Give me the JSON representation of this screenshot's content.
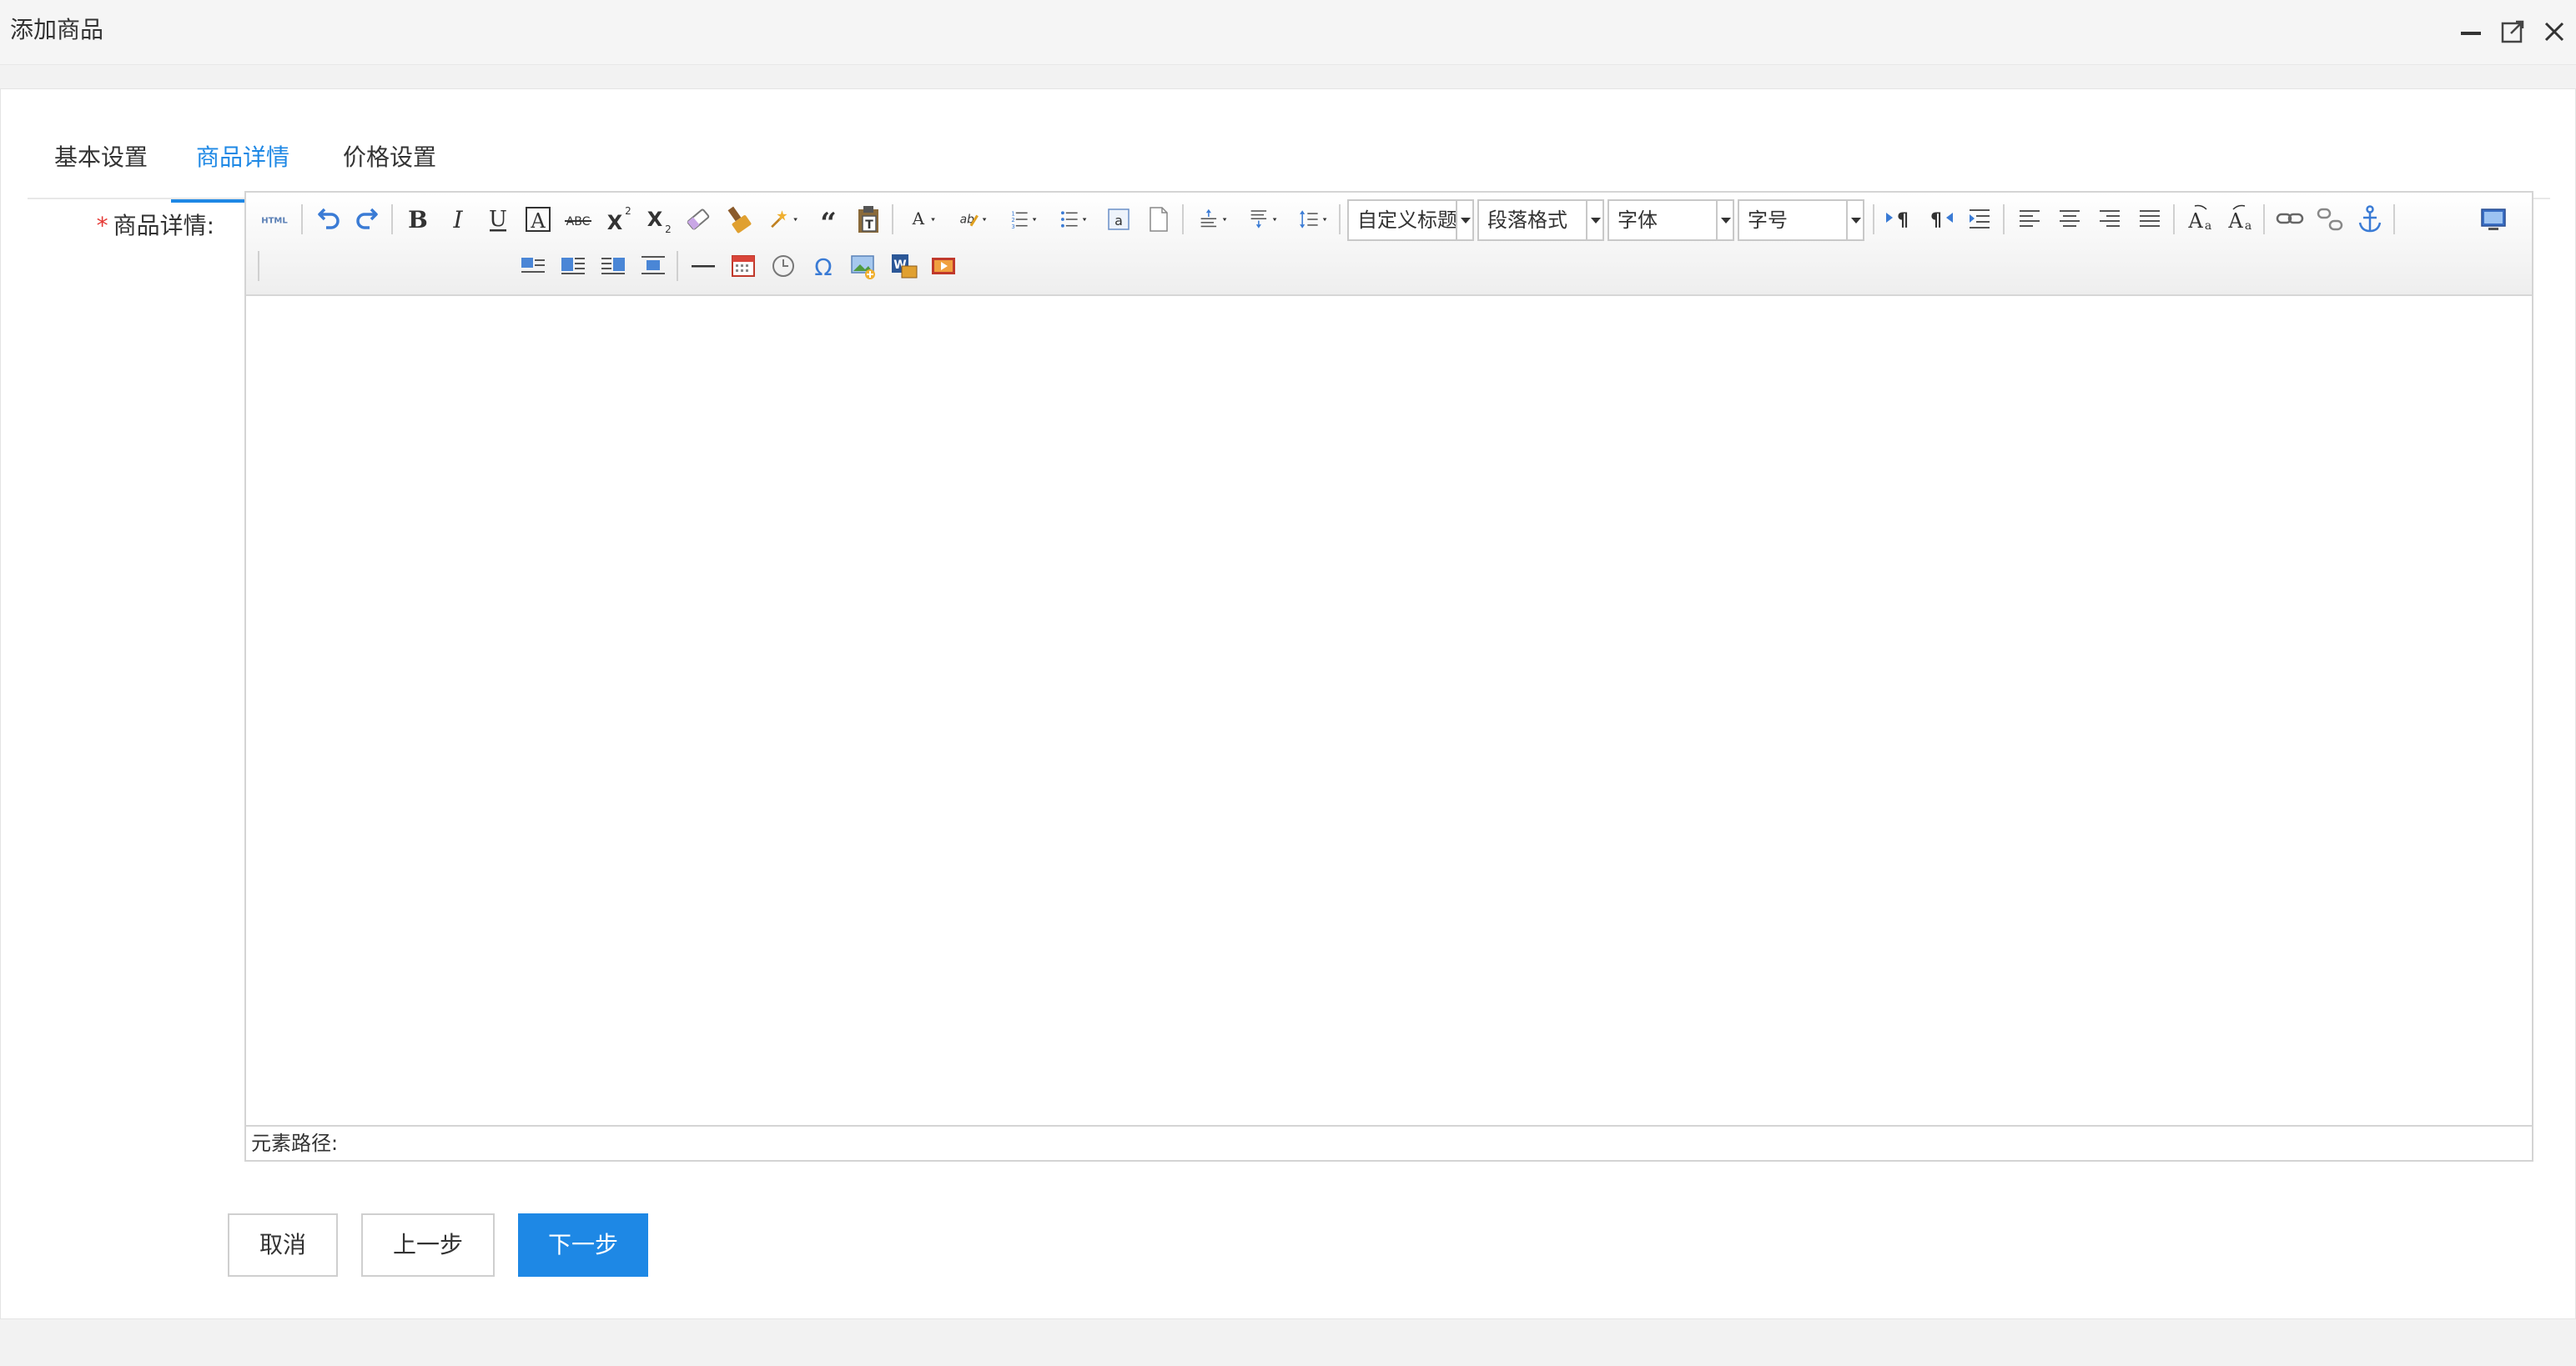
{
  "window": {
    "title": "添加商品",
    "controls": [
      "minimize-icon",
      "maximize-icon",
      "close-icon"
    ]
  },
  "tabs": [
    {
      "label": "基本设置",
      "active": false
    },
    {
      "label": "商品详情",
      "active": true
    },
    {
      "label": "价格设置",
      "active": false
    }
  ],
  "form": {
    "required_mark": "*",
    "detail_label": "商品详情:"
  },
  "editor": {
    "toolbar": {
      "source_button": "HTML",
      "dropdowns": {
        "custom_heading": "自定义标题",
        "paragraph_format": "段落格式",
        "font_family": "字体",
        "font_size": "字号"
      },
      "row1_icons": [
        "html-source-icon",
        "undo-icon",
        "redo-icon",
        "bold-icon",
        "italic-icon",
        "underline-icon",
        "font-border-icon",
        "strikethrough-icon",
        "superscript-icon",
        "subscript-icon",
        "eraser-icon",
        "format-painter-icon",
        "auto-typeset-icon",
        "blockquote-icon",
        "paste-plain-icon",
        "font-color-icon",
        "highlight-color-icon",
        "ordered-list-icon",
        "unordered-list-icon",
        "select-all-icon",
        "clear-doc-icon",
        "row-spacing-top-icon",
        "row-spacing-bottom-icon",
        "line-height-icon",
        "ltr-icon",
        "rtl-icon",
        "indent-icon",
        "align-left-icon",
        "align-center-icon",
        "align-right-icon",
        "align-justify-icon",
        "uppercase-icon",
        "lowercase-icon",
        "link-icon",
        "unlink-icon",
        "anchor-icon",
        "preview-icon"
      ],
      "row2_icons": [
        "image-none-icon",
        "image-left-icon",
        "image-right-icon",
        "image-center-icon",
        "horizontal-rule-icon",
        "date-icon",
        "time-icon",
        "special-char-icon",
        "insert-image-icon",
        "word-image-icon",
        "insert-video-icon"
      ]
    },
    "element_path_label": "元素路径:"
  },
  "actions": {
    "cancel": "取消",
    "previous": "上一步",
    "next": "下一步"
  },
  "colors": {
    "accent": "#1e88e5",
    "required": "#e53935",
    "border": "#d4d4d4",
    "background": "#f2f2f2"
  }
}
